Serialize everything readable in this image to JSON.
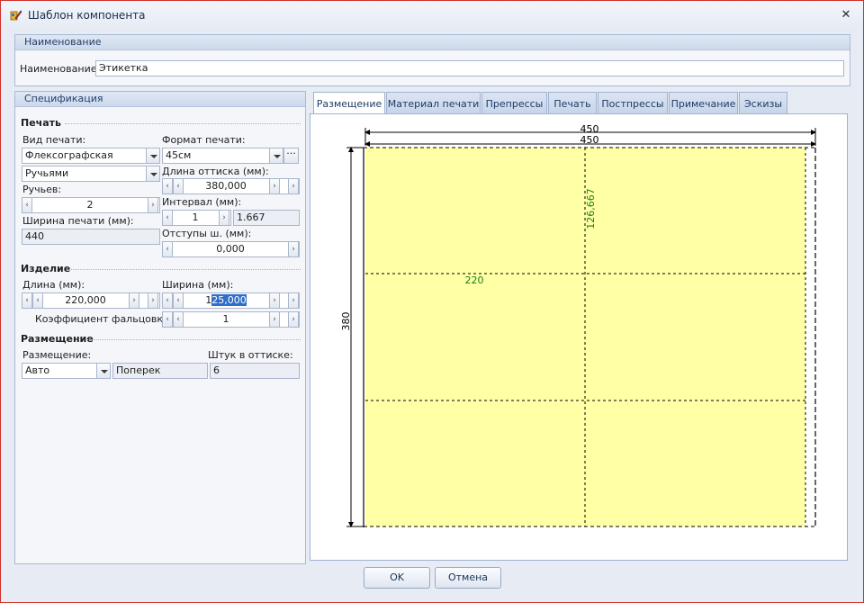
{
  "window": {
    "title": "Шаблон компонента"
  },
  "name_group": {
    "header": "Наименование",
    "label": "Наименование:",
    "value": "Этикетка"
  },
  "spec": {
    "header": "Спецификация",
    "print_section": "Печать",
    "print_type_label": "Вид печати:",
    "print_type_value": "Флексографская",
    "print_format_label": "Формат печати:",
    "print_format_value": "45см",
    "streams_mode_value": "Ручьями",
    "impression_length_label": "Длина оттиска (мм):",
    "impression_length_value": "380,000",
    "streams_label": "Ручьев:",
    "streams_value": "2",
    "interval_label": "Интервал (мм):",
    "interval_value": "1",
    "interval_computed": "1.667",
    "print_width_label": "Ширина печати (мм):",
    "print_width_value": "440",
    "offsets_label": "Отступы ш. (мм):",
    "offsets_value": "0,000",
    "product_section": "Изделие",
    "length_label": "Длина (мм):",
    "length_value": "220,000",
    "width_label": "Ширина (мм):",
    "width_value_pre": "1",
    "width_value_sel": "25,000",
    "fold_label": "Коэффициент фальцовки:",
    "fold_value": "1",
    "placement_section": "Размещение",
    "placement_label": "Размещение:",
    "placement_value": "Авто",
    "orientation_value": "Поперек",
    "pieces_label": "Штук в оттиске:",
    "pieces_value": "6"
  },
  "tabs": [
    "Размещение",
    "Материал печати",
    "Препрессы",
    "Печать",
    "Постпрессы",
    "Примечание",
    "Эскизы"
  ],
  "layout_view": {
    "dim_total_width": "450",
    "dim_inner_width": "450",
    "dim_height": "380",
    "label_width": "220",
    "label_height": "126,667",
    "fill_color": "#ffffa6",
    "dim_label_color": "#1a7f1a",
    "rows": 3,
    "columns": 2
  },
  "buttons": {
    "ok": "OK",
    "cancel": "Отмена"
  }
}
